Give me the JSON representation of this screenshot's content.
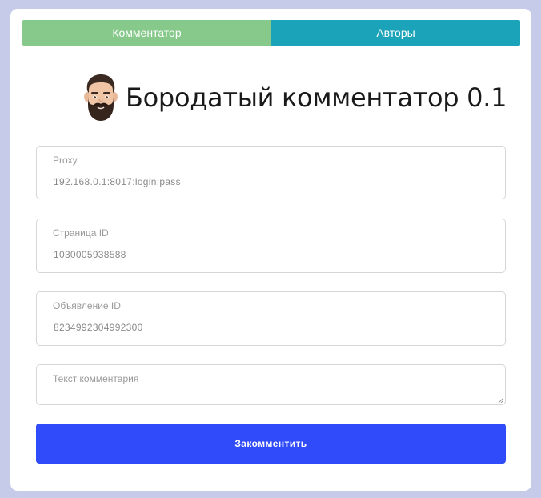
{
  "tabs": [
    {
      "label": "Комментатор",
      "color": "#86c98a"
    },
    {
      "label": "Авторы",
      "color": "#1ba3ba"
    }
  ],
  "header": {
    "icon": "bearded-man-emoji-icon",
    "title": "Бородатый комментатор 0.1"
  },
  "fields": {
    "proxy": {
      "label": "Proxy",
      "value": "192.168.0.1:8017:login:pass"
    },
    "page_id": {
      "label": "Страница ID",
      "value": "1030005938588"
    },
    "ad_id": {
      "label": "Объявление ID",
      "value": "8234992304992300"
    },
    "comment": {
      "label": "Текст комментария",
      "value": ""
    }
  },
  "submit": {
    "label": "Закомментить",
    "color": "#2f4bfa"
  },
  "colors": {
    "background": "#c7cbea",
    "card": "#ffffff"
  }
}
